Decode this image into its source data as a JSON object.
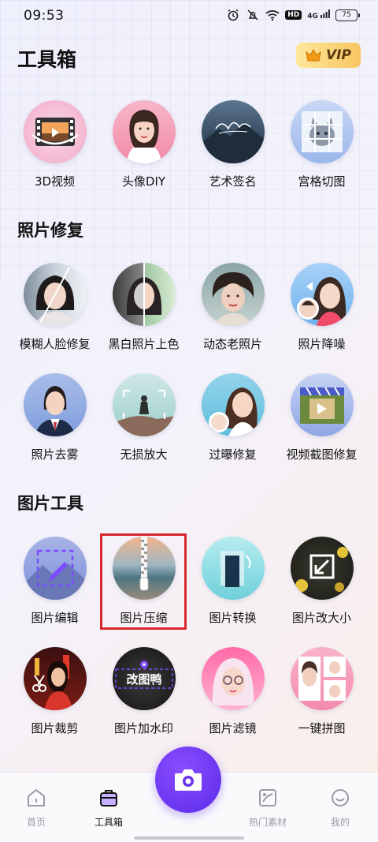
{
  "status_bar": {
    "time": "09:53",
    "hd": "HD",
    "signal": "4G",
    "battery": "75"
  },
  "header": {
    "title": "工具箱",
    "vip_label": "VIP"
  },
  "top_tools": [
    {
      "label": "3D视频",
      "icon": "film-3d-icon"
    },
    {
      "label": "头像DIY",
      "icon": "avatar-portrait"
    },
    {
      "label": "艺术签名",
      "icon": "signature-art"
    },
    {
      "label": "宫格切图",
      "icon": "grid-cut-cat"
    }
  ],
  "sections": {
    "photo_repair": {
      "title": "照片修复"
    },
    "photo_tools": {
      "title": "图片工具"
    }
  },
  "repair_tools_row1": [
    {
      "label": "模糊人脸修复"
    },
    {
      "label": "黑白照片上色"
    },
    {
      "label": "动态老照片"
    },
    {
      "label": "照片降噪"
    }
  ],
  "repair_tools_row2": [
    {
      "label": "照片去雾"
    },
    {
      "label": "无损放大"
    },
    {
      "label": "过曝修复"
    },
    {
      "label": "视频截图修复"
    }
  ],
  "image_tools_row1": [
    {
      "label": "图片编辑"
    },
    {
      "label": "图片压缩"
    },
    {
      "label": "图片转换"
    },
    {
      "label": "图片改大小"
    }
  ],
  "image_tools_row2": [
    {
      "label": "图片裁剪"
    },
    {
      "label": "图片加水印",
      "thumb_text": "改图鸭"
    },
    {
      "label": "图片滤镜"
    },
    {
      "label": "一键拼图"
    }
  ],
  "bottom_nav": {
    "home": "首页",
    "toolbox": "工具箱",
    "hot_materials": "热门素材",
    "mine": "我的"
  },
  "colors": {
    "accent": "#5a2be8",
    "highlight": "#d8262f",
    "vip": "#f7c561"
  }
}
